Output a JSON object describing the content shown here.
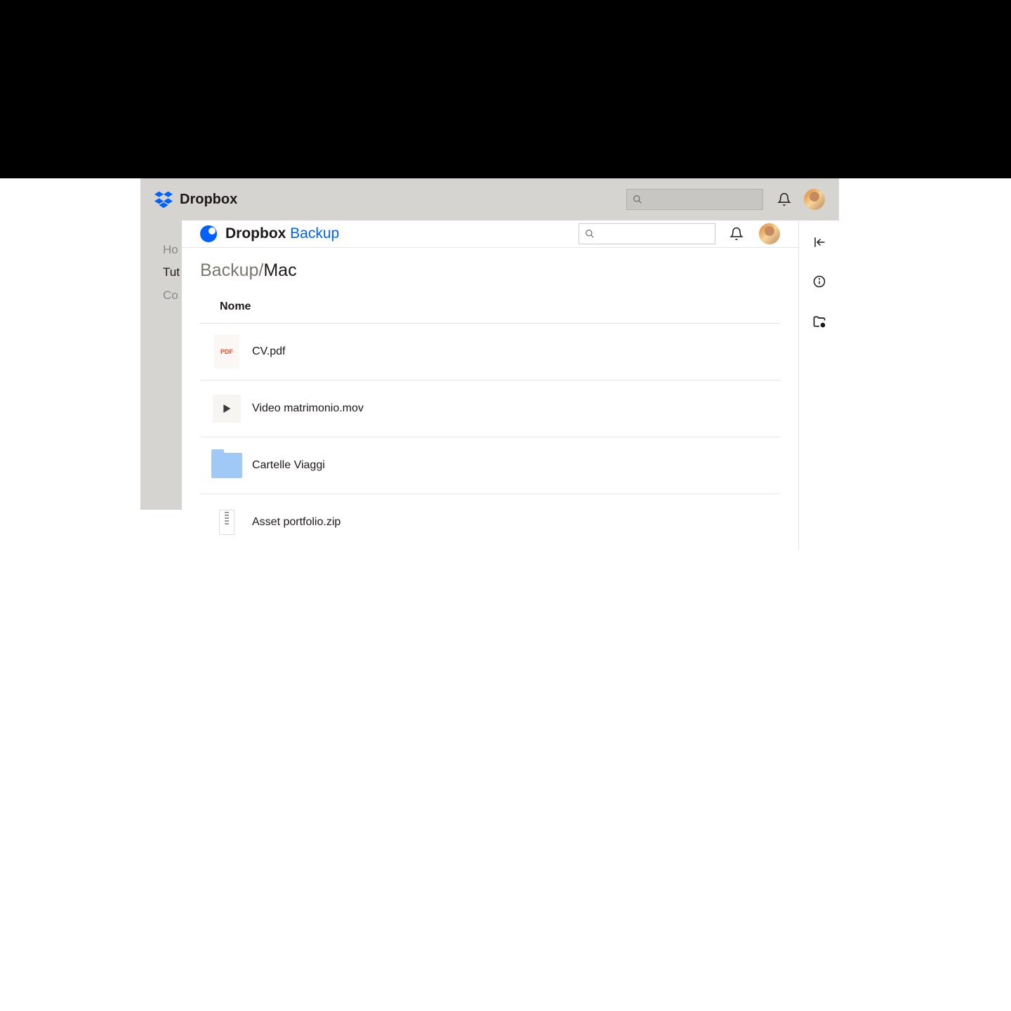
{
  "main_header": {
    "brand": "Dropbox"
  },
  "sidebar": {
    "items": [
      {
        "label": "Ho"
      },
      {
        "label": "Tut"
      },
      {
        "label": "Co"
      }
    ]
  },
  "backup": {
    "brand_a": "Dropbox ",
    "brand_b": "Backup",
    "breadcrumb_prefix": "Backup",
    "breadcrumb_sep": "/",
    "breadcrumb_current": "Mac",
    "column_header": "Nome",
    "files": [
      {
        "name": "CV.pdf",
        "type": "pdf"
      },
      {
        "name": "Video matrimonio.mov",
        "type": "video"
      },
      {
        "name": "Cartelle Viaggi",
        "type": "folder"
      },
      {
        "name": "Asset portfolio.zip",
        "type": "zip"
      }
    ],
    "pdf_label": "PDF"
  }
}
